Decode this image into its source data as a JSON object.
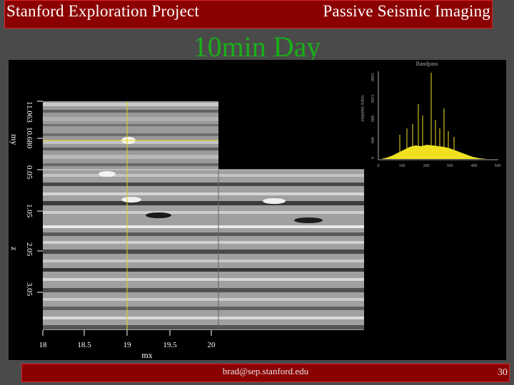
{
  "header": {
    "left_text": "Stanford Exploration Project",
    "right_text": "Passive Seismic Imaging"
  },
  "slide": {
    "title": "10min Day"
  },
  "seismic_panel": {
    "axis_x_label": "mx",
    "axis_x_ticks": [
      "18",
      "18.5",
      "19",
      "19.5",
      "20"
    ],
    "axis_y_top_label": "my",
    "axis_y_top_ticks": [
      "11.063",
      "10.680"
    ],
    "axis_y_bottom_label": "z",
    "axis_y_bottom_ticks": [
      "0.05",
      "1.05",
      "2.05",
      "3.05"
    ],
    "crosshair_color": "#e6d21a"
  },
  "spectrum_panel": {
    "title": "Bandpass",
    "y_axis_label": "trace number",
    "y_ticks": [
      "0",
      "400",
      "800",
      "1200",
      "1600"
    ],
    "x_ticks": [
      "0",
      "100",
      "200",
      "300",
      "400",
      "500"
    ],
    "trace_color": "#f0e020"
  },
  "footer": {
    "email": "brad@sep.stanford.edu",
    "page_number": "30"
  },
  "colors": {
    "header_bg": "#8b0000",
    "title_green": "#18b018",
    "viewer_bg": "#000000"
  }
}
